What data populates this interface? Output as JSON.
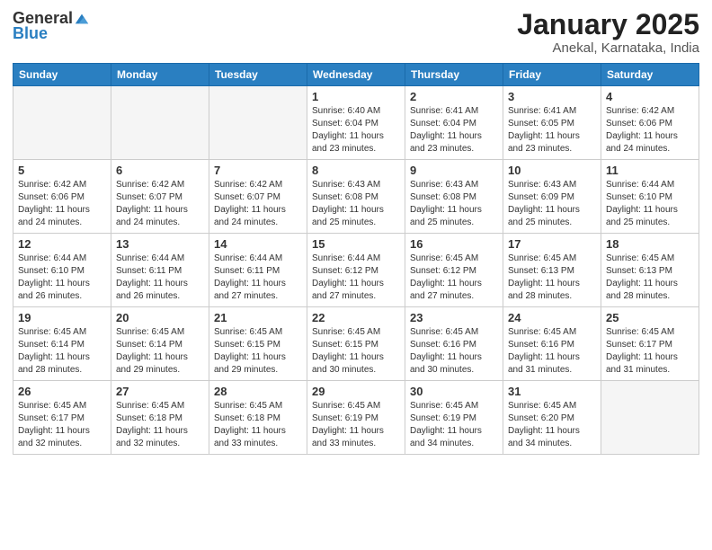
{
  "header": {
    "logo_general": "General",
    "logo_blue": "Blue",
    "title": "January 2025",
    "subtitle": "Anekal, Karnataka, India"
  },
  "days_of_week": [
    "Sunday",
    "Monday",
    "Tuesday",
    "Wednesday",
    "Thursday",
    "Friday",
    "Saturday"
  ],
  "weeks": [
    [
      {
        "day": "",
        "info": ""
      },
      {
        "day": "",
        "info": ""
      },
      {
        "day": "",
        "info": ""
      },
      {
        "day": "1",
        "info": "Sunrise: 6:40 AM\nSunset: 6:04 PM\nDaylight: 11 hours\nand 23 minutes."
      },
      {
        "day": "2",
        "info": "Sunrise: 6:41 AM\nSunset: 6:04 PM\nDaylight: 11 hours\nand 23 minutes."
      },
      {
        "day": "3",
        "info": "Sunrise: 6:41 AM\nSunset: 6:05 PM\nDaylight: 11 hours\nand 23 minutes."
      },
      {
        "day": "4",
        "info": "Sunrise: 6:42 AM\nSunset: 6:06 PM\nDaylight: 11 hours\nand 24 minutes."
      }
    ],
    [
      {
        "day": "5",
        "info": "Sunrise: 6:42 AM\nSunset: 6:06 PM\nDaylight: 11 hours\nand 24 minutes."
      },
      {
        "day": "6",
        "info": "Sunrise: 6:42 AM\nSunset: 6:07 PM\nDaylight: 11 hours\nand 24 minutes."
      },
      {
        "day": "7",
        "info": "Sunrise: 6:42 AM\nSunset: 6:07 PM\nDaylight: 11 hours\nand 24 minutes."
      },
      {
        "day": "8",
        "info": "Sunrise: 6:43 AM\nSunset: 6:08 PM\nDaylight: 11 hours\nand 25 minutes."
      },
      {
        "day": "9",
        "info": "Sunrise: 6:43 AM\nSunset: 6:08 PM\nDaylight: 11 hours\nand 25 minutes."
      },
      {
        "day": "10",
        "info": "Sunrise: 6:43 AM\nSunset: 6:09 PM\nDaylight: 11 hours\nand 25 minutes."
      },
      {
        "day": "11",
        "info": "Sunrise: 6:44 AM\nSunset: 6:10 PM\nDaylight: 11 hours\nand 25 minutes."
      }
    ],
    [
      {
        "day": "12",
        "info": "Sunrise: 6:44 AM\nSunset: 6:10 PM\nDaylight: 11 hours\nand 26 minutes."
      },
      {
        "day": "13",
        "info": "Sunrise: 6:44 AM\nSunset: 6:11 PM\nDaylight: 11 hours\nand 26 minutes."
      },
      {
        "day": "14",
        "info": "Sunrise: 6:44 AM\nSunset: 6:11 PM\nDaylight: 11 hours\nand 27 minutes."
      },
      {
        "day": "15",
        "info": "Sunrise: 6:44 AM\nSunset: 6:12 PM\nDaylight: 11 hours\nand 27 minutes."
      },
      {
        "day": "16",
        "info": "Sunrise: 6:45 AM\nSunset: 6:12 PM\nDaylight: 11 hours\nand 27 minutes."
      },
      {
        "day": "17",
        "info": "Sunrise: 6:45 AM\nSunset: 6:13 PM\nDaylight: 11 hours\nand 28 minutes."
      },
      {
        "day": "18",
        "info": "Sunrise: 6:45 AM\nSunset: 6:13 PM\nDaylight: 11 hours\nand 28 minutes."
      }
    ],
    [
      {
        "day": "19",
        "info": "Sunrise: 6:45 AM\nSunset: 6:14 PM\nDaylight: 11 hours\nand 28 minutes."
      },
      {
        "day": "20",
        "info": "Sunrise: 6:45 AM\nSunset: 6:14 PM\nDaylight: 11 hours\nand 29 minutes."
      },
      {
        "day": "21",
        "info": "Sunrise: 6:45 AM\nSunset: 6:15 PM\nDaylight: 11 hours\nand 29 minutes."
      },
      {
        "day": "22",
        "info": "Sunrise: 6:45 AM\nSunset: 6:15 PM\nDaylight: 11 hours\nand 30 minutes."
      },
      {
        "day": "23",
        "info": "Sunrise: 6:45 AM\nSunset: 6:16 PM\nDaylight: 11 hours\nand 30 minutes."
      },
      {
        "day": "24",
        "info": "Sunrise: 6:45 AM\nSunset: 6:16 PM\nDaylight: 11 hours\nand 31 minutes."
      },
      {
        "day": "25",
        "info": "Sunrise: 6:45 AM\nSunset: 6:17 PM\nDaylight: 11 hours\nand 31 minutes."
      }
    ],
    [
      {
        "day": "26",
        "info": "Sunrise: 6:45 AM\nSunset: 6:17 PM\nDaylight: 11 hours\nand 32 minutes."
      },
      {
        "day": "27",
        "info": "Sunrise: 6:45 AM\nSunset: 6:18 PM\nDaylight: 11 hours\nand 32 minutes."
      },
      {
        "day": "28",
        "info": "Sunrise: 6:45 AM\nSunset: 6:18 PM\nDaylight: 11 hours\nand 33 minutes."
      },
      {
        "day": "29",
        "info": "Sunrise: 6:45 AM\nSunset: 6:19 PM\nDaylight: 11 hours\nand 33 minutes."
      },
      {
        "day": "30",
        "info": "Sunrise: 6:45 AM\nSunset: 6:19 PM\nDaylight: 11 hours\nand 34 minutes."
      },
      {
        "day": "31",
        "info": "Sunrise: 6:45 AM\nSunset: 6:20 PM\nDaylight: 11 hours\nand 34 minutes."
      },
      {
        "day": "",
        "info": ""
      }
    ]
  ]
}
